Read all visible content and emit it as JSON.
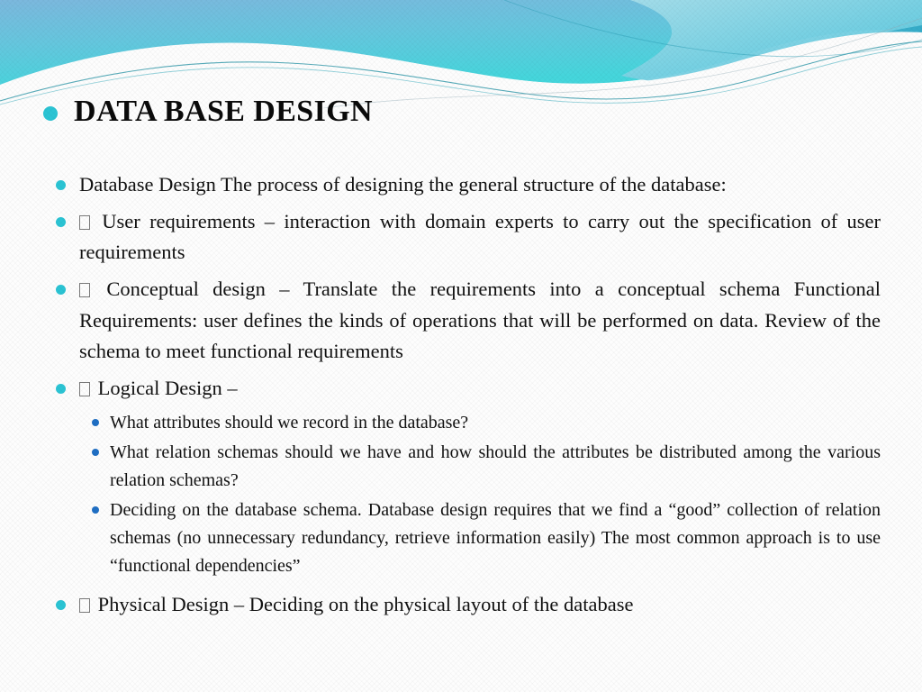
{
  "slide": {
    "title": "DATA BASE DESIGN",
    "colors": {
      "title_bullet": "#2BC4D4",
      "level1_bullet": "#2BC4D4",
      "level2_bullet": "#1F6FC4",
      "text": "#111111",
      "background": "#FDFDFD",
      "wave_blue": "#7FC4E8",
      "wave_cyan": "#49D2DE",
      "wave_teal": "#3FB6CF",
      "wave_line": "#1F7F92"
    },
    "bullets": [
      {
        "level": 1,
        "tofu": false,
        "text": "Database Design The process of designing the general structure of the database:"
      },
      {
        "level": 1,
        "tofu": true,
        "text": "User requirements – interaction with domain experts to carry out the specification of user requirements"
      },
      {
        "level": 1,
        "tofu": true,
        "text": "Conceptual design – Translate the requirements into a conceptual schema Functional Requirements: user defines the kinds of operations that will be performed on data. Review of the schema to meet functional requirements"
      },
      {
        "level": 1,
        "tofu": true,
        "text": "Logical Design –"
      },
      {
        "level": 2,
        "tofu": false,
        "text": "What attributes should we record in the database?"
      },
      {
        "level": 2,
        "tofu": false,
        "text": "What relation schemas should we have and how should the attributes be distributed among the various relation schemas?"
      },
      {
        "level": 2,
        "tofu": false,
        "text": "Deciding on the database schema. Database design requires that we find a “good” collection of relation schemas (no unnecessary redundancy, retrieve information easily) The most common approach is to use “functional dependencies”"
      },
      {
        "level": 1,
        "tofu": true,
        "text": "Physical Design – Deciding on the physical layout of the database"
      }
    ]
  }
}
